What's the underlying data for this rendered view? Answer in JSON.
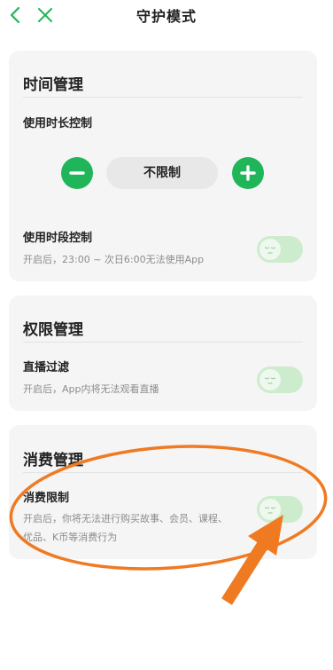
{
  "header": {
    "title": "守护模式",
    "back_icon": "chevron-left-icon",
    "close_icon": "close-icon"
  },
  "colors": {
    "accent": "#21b55a",
    "toggle_off": "#cdeccd",
    "annotation": "#f07a22"
  },
  "time_card": {
    "title": "时间管理",
    "duration": {
      "label": "使用时长控制",
      "value": "不限制",
      "decrease_icon": "minus-icon",
      "increase_icon": "plus-icon"
    },
    "period": {
      "label": "使用时段控制",
      "desc": "开启后，23:00 ~ 次日6:00无法使用App",
      "enabled": false
    }
  },
  "permission_card": {
    "title": "权限管理",
    "live_filter": {
      "label": "直播过滤",
      "desc": "开启后，App内将无法观看直播",
      "enabled": false
    }
  },
  "consumption_card": {
    "title": "消费管理",
    "limit": {
      "label": "消费限制",
      "desc_line1": "开启后，你将无法进行购买故事、会员、课程、",
      "desc_line2": "优品、K币等消费行为",
      "enabled": false
    }
  }
}
